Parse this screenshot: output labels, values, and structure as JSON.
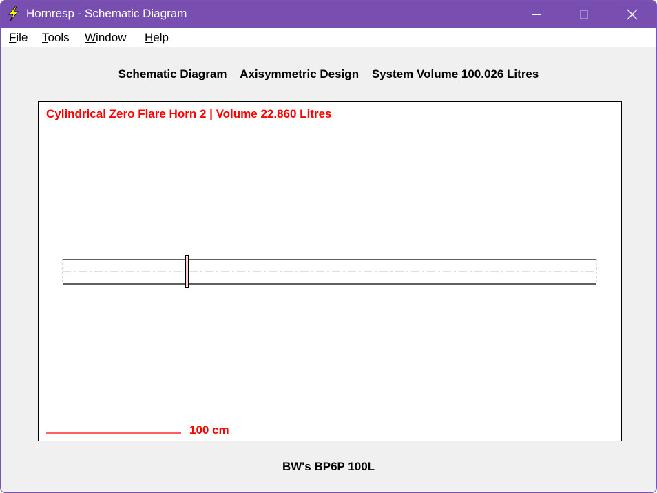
{
  "window": {
    "title": "Hornresp - Schematic Diagram"
  },
  "menu": {
    "file": {
      "mnemonic": "F",
      "rest": "ile"
    },
    "tools": {
      "mnemonic": "T",
      "rest": "ools"
    },
    "window": {
      "mnemonic": "W",
      "rest": "indow"
    },
    "help": {
      "mnemonic": "H",
      "rest": "elp"
    }
  },
  "header": {
    "diagram_label": "Schematic Diagram",
    "design_label": "Axisymmetric Design",
    "volume_label": "System Volume 100.026 Litres"
  },
  "diagram": {
    "title": "Cylindrical Zero Flare Horn 2 | Volume 22.860 Litres",
    "scale_label": "100 cm"
  },
  "footer": {
    "project_name": "BW's BP6P 100L"
  },
  "colors": {
    "titlebar": "#784fb0",
    "horn_title": "#ff0000",
    "driver": "#ff0000",
    "centerline": "#c0c0c0"
  },
  "icons": {
    "app": "lightning-bolt-icon",
    "minimize": "minimize-icon",
    "maximize": "maximize-icon",
    "close": "close-icon"
  }
}
